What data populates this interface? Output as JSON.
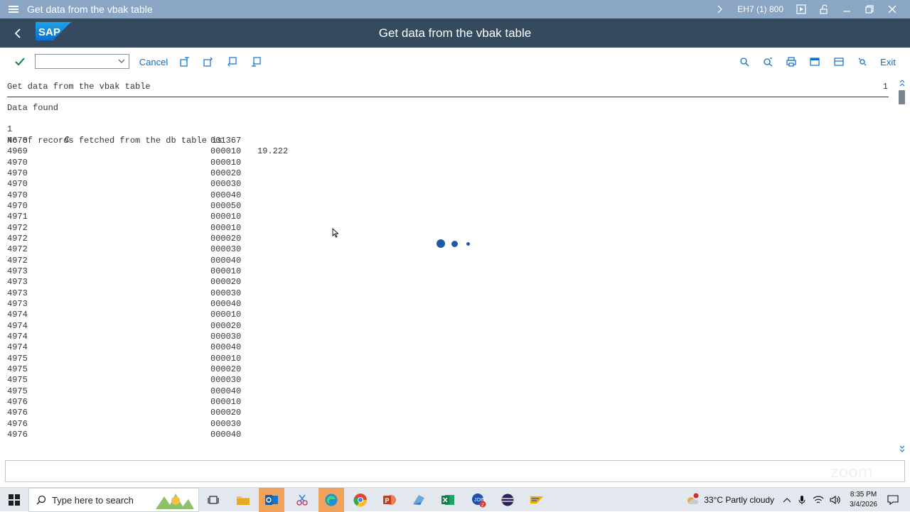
{
  "window": {
    "title": "Get data from the vbak table",
    "system_info": "EH7 (1) 800"
  },
  "shell": {
    "logo_text": "SAP",
    "heading": "Get data from the vbak table"
  },
  "toolbar": {
    "command_field_value": "",
    "cancel_label": "Cancel",
    "exit_label": "Exit"
  },
  "list": {
    "header_title": "Get data from the vbak table",
    "page_number": "1",
    "line_data_found": "Data found",
    "line_2_a": "1",
    "line_2_b": "C",
    "line_records": "No of records fetched from the db table is",
    "records_value": "19.222",
    "rows": [
      {
        "id": "4678",
        "item": "001367"
      },
      {
        "id": "4969",
        "item": "000010"
      },
      {
        "id": "4970",
        "item": "000010"
      },
      {
        "id": "4970",
        "item": "000020"
      },
      {
        "id": "4970",
        "item": "000030"
      },
      {
        "id": "4970",
        "item": "000040"
      },
      {
        "id": "4970",
        "item": "000050"
      },
      {
        "id": "4971",
        "item": "000010"
      },
      {
        "id": "4972",
        "item": "000010"
      },
      {
        "id": "4972",
        "item": "000020"
      },
      {
        "id": "4972",
        "item": "000030"
      },
      {
        "id": "4972",
        "item": "000040"
      },
      {
        "id": "4973",
        "item": "000010"
      },
      {
        "id": "4973",
        "item": "000020"
      },
      {
        "id": "4973",
        "item": "000030"
      },
      {
        "id": "4973",
        "item": "000040"
      },
      {
        "id": "4974",
        "item": "000010"
      },
      {
        "id": "4974",
        "item": "000020"
      },
      {
        "id": "4974",
        "item": "000030"
      },
      {
        "id": "4974",
        "item": "000040"
      },
      {
        "id": "4975",
        "item": "000010"
      },
      {
        "id": "4975",
        "item": "000020"
      },
      {
        "id": "4975",
        "item": "000030"
      },
      {
        "id": "4975",
        "item": "000040"
      },
      {
        "id": "4976",
        "item": "000010"
      },
      {
        "id": "4976",
        "item": "000020"
      },
      {
        "id": "4976",
        "item": "000030"
      },
      {
        "id": "4976",
        "item": "000040"
      }
    ]
  },
  "statusbar": {
    "watermark": "zoom"
  },
  "taskbar": {
    "search_placeholder": "Type here to search",
    "weather": "33°C  Partly cloudy",
    "time": "8:35 PM",
    "date": "3/4/2026",
    "outlook_badge": "2"
  },
  "colors": {
    "titlebar": "#8aa6c4",
    "shell": "#354a5f",
    "accent": "#0a6ed1",
    "active_tile": "#f0a25d"
  }
}
